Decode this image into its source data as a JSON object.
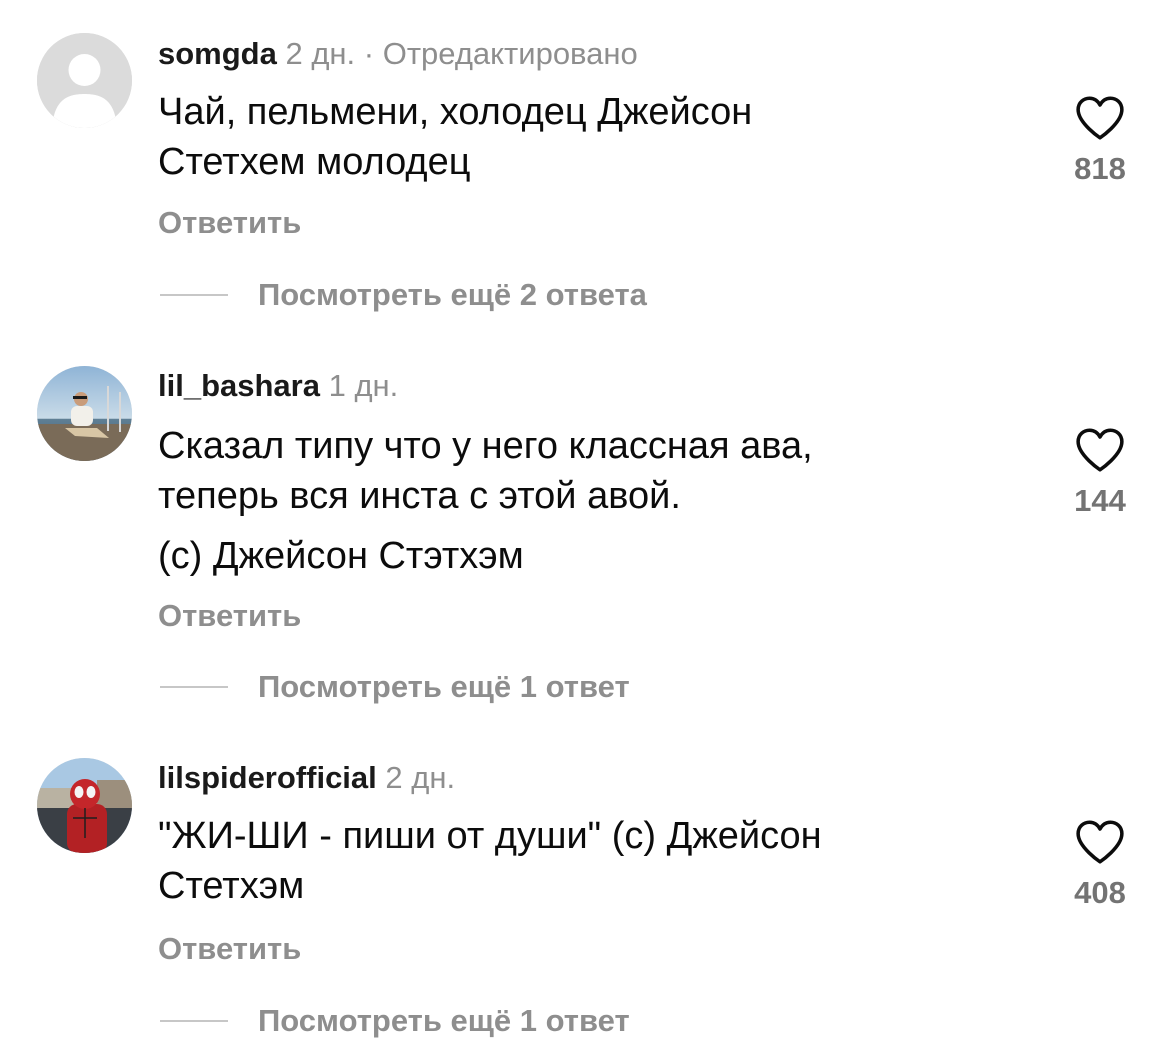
{
  "comments": [
    {
      "username": "somgda",
      "time": "2 дн. · Отредактировано",
      "lines": [
        "Чай, пельмени, холодец Джейсон",
        "Стетхем молодец"
      ],
      "reply_label": "Ответить",
      "view_replies": "Посмотреть ещё 2 ответа",
      "likes": "818",
      "avatar": "default-avatar-icon"
    },
    {
      "username": "lil_bashara",
      "time": "1 дн.",
      "lines": [
        "Сказал типу что у него классная ава,",
        "теперь вся инста с этой авой.",
        "(с) Джейсон Стэтхэм"
      ],
      "reply_label": "Ответить",
      "view_replies": "Посмотреть ещё 1 ответ",
      "likes": "144",
      "avatar": "photo-avatar"
    },
    {
      "username": "lilspiderofficial",
      "time": "2 дн.",
      "lines": [
        "\"ЖИ-ШИ - пиши от души\" (с) Джейсон",
        "Стетхэм"
      ],
      "reply_label": "Ответить",
      "view_replies": "Посмотреть ещё 1 ответ",
      "likes": "408",
      "avatar": "photo-avatar"
    }
  ],
  "colors": {
    "text": "#0c0c0c",
    "secondary": "#8e8e8e",
    "like_count": "#737373",
    "divider": "#c7c7c7"
  }
}
